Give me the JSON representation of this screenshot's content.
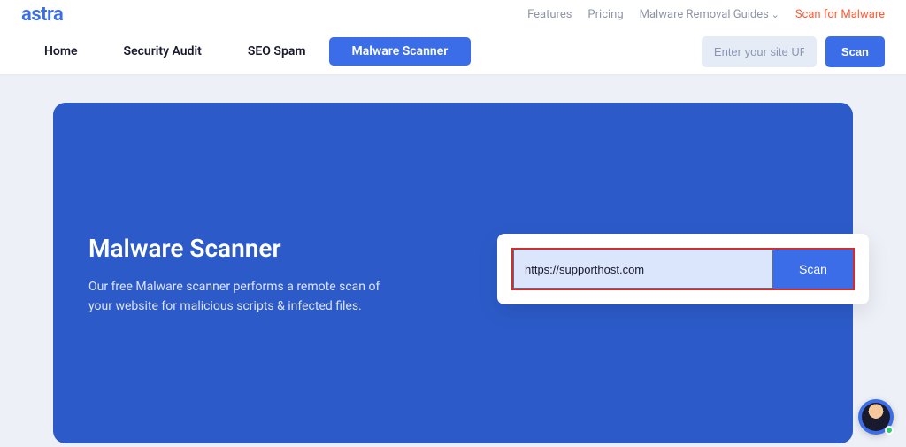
{
  "brand": {
    "logo": "astra"
  },
  "topNav": {
    "links": [
      "Features",
      "Pricing",
      "Malware Removal Guides"
    ],
    "cta": "Scan for Malware"
  },
  "mainNav": {
    "tabs": [
      {
        "label": "Home",
        "active": false
      },
      {
        "label": "Security Audit",
        "active": false
      },
      {
        "label": "SEO Spam",
        "active": false
      },
      {
        "label": "Malware Scanner",
        "active": true
      }
    ],
    "urlPlaceholder": "Enter your site URL",
    "scanLabel": "Scan"
  },
  "hero": {
    "title": "Malware Scanner",
    "description": "Our free Malware scanner performs a remote scan of your website for malicious scripts & infected files.",
    "inputValue": "https://supporthost.com",
    "scanLabel": "Scan"
  }
}
